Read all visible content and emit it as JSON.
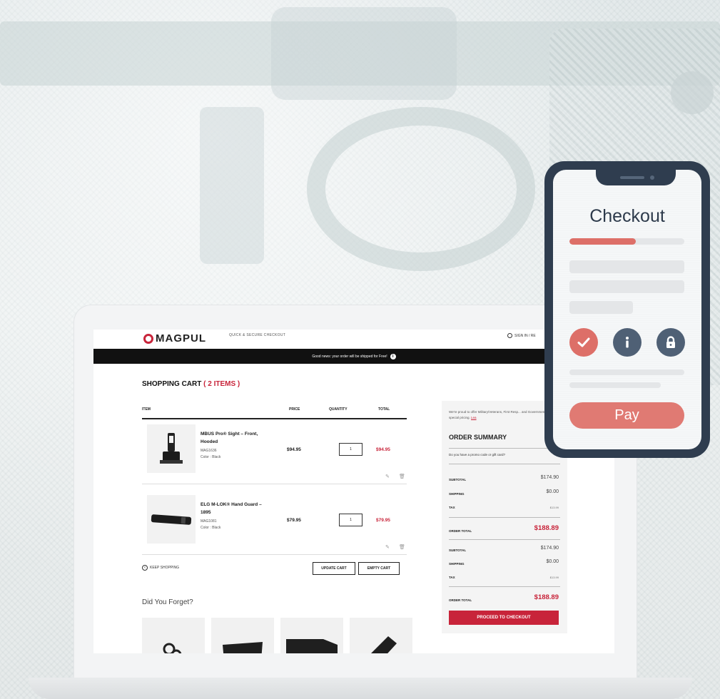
{
  "colors": {
    "brand_red": "#c8243a",
    "phone_frame": "#2f3d4f",
    "phone_accent": "#dd6f68"
  },
  "header": {
    "logo": "MAGPUL",
    "tagline": "QUICK & SECURE CHECKOUT",
    "signin": "SIGN IN / RE"
  },
  "promo_banner": "Good news: your order will be shipped for Free!",
  "cart": {
    "title": "SHOPPING CART",
    "count": "( 2 ITEMS )",
    "columns": {
      "item": "ITEM",
      "price": "PRICE",
      "quantity": "QUANTITY",
      "total": "TOTAL"
    },
    "items": [
      {
        "name": "MBUS Pro® Sight – Front, Hooded",
        "sku": "MAG1636",
        "color": "Color : Black",
        "price": "$94.95",
        "qty": "1",
        "total": "$94.95"
      },
      {
        "name": "ELG M-LOK® Hand Guard – 1895",
        "sku": "MAG1081",
        "color": "Color : Black",
        "price": "$79.95",
        "qty": "1",
        "total": "$79.95"
      }
    ],
    "keep_shopping": "KEEP SHOPPING",
    "update_cart": "UPDATE CART",
    "empty_cart": "EMPTY CART",
    "did_you_forget": "Did You Forget?"
  },
  "summary": {
    "note": "We're proud to offer Military/Veterans, First Resp... and Government Employees special pricing.",
    "note_link": "Lea",
    "title": "ORDER SUMMARY",
    "promo_question": "Do you have a promo code or gift card?",
    "block1": {
      "subtotal_label": "SUBTOTAL",
      "subtotal": "$174.90",
      "shipping_label": "SHIPPING",
      "shipping": "$0.00",
      "tax_label": "TAX",
      "tax": "$13.99",
      "total_label": "ORDER TOTAL",
      "total": "$188.89"
    },
    "block2": {
      "subtotal_label": "SUBTOTAL",
      "subtotal": "$174.90",
      "shipping_label": "SHIPPING",
      "shipping": "$0.00",
      "tax_label": "TAX",
      "tax": "$13.99",
      "total_label": "ORDER TOTAL",
      "total": "$188.89"
    },
    "checkout_button": "PROCEED TO CHECKOUT"
  },
  "phone": {
    "title": "Checkout",
    "progress": 0.58,
    "pay_button": "Pay",
    "icons": [
      "check-icon",
      "info-icon",
      "lock-icon"
    ]
  }
}
